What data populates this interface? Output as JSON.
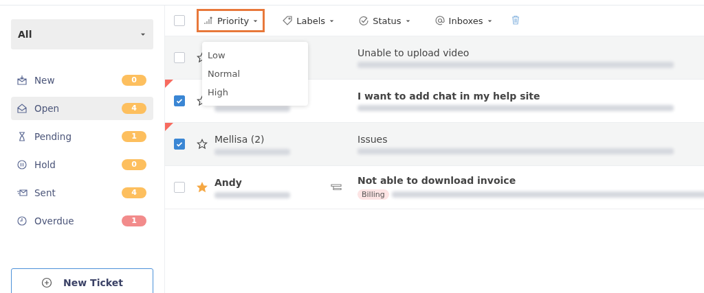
{
  "sidebar": {
    "filter": {
      "value": "All"
    },
    "items": [
      {
        "kind": "new",
        "label": "New",
        "count": "0",
        "color": "#fdbf5e",
        "selected": false
      },
      {
        "kind": "open",
        "label": "Open",
        "count": "4",
        "color": "#fdbf5e",
        "selected": true
      },
      {
        "kind": "pending",
        "label": "Pending",
        "count": "1",
        "color": "#fdbf5e",
        "selected": false
      },
      {
        "kind": "hold",
        "label": "Hold",
        "count": "0",
        "color": "#fdbf5e",
        "selected": false
      },
      {
        "kind": "sent",
        "label": "Sent",
        "count": "4",
        "color": "#fdbf5e",
        "selected": false
      },
      {
        "kind": "overdue",
        "label": "Overdue",
        "count": "1",
        "color": "#f28b8b",
        "selected": false
      }
    ],
    "new_ticket_button": "New Ticket"
  },
  "toolbar": {
    "select_all_checked": false,
    "buttons": [
      {
        "kind": "priority",
        "label": "Priority",
        "highlighted": true
      },
      {
        "kind": "labels",
        "label": "Labels",
        "highlighted": false
      },
      {
        "kind": "status",
        "label": "Status",
        "highlighted": false
      },
      {
        "kind": "inboxes",
        "label": "Inboxes",
        "highlighted": false
      }
    ]
  },
  "priority_menu": [
    "Low",
    "Normal",
    "High"
  ],
  "tickets": [
    {
      "checked": false,
      "starred": false,
      "flagged": false,
      "read": true,
      "has_note": false,
      "subject": "Unable to upload video"
    },
    {
      "checked": true,
      "starred": false,
      "flagged": true,
      "read": false,
      "has_note": false,
      "subject": "I want to add chat in my help site"
    },
    {
      "checked": true,
      "starred": false,
      "flagged": true,
      "read": true,
      "has_note": false,
      "name": "Mellisa (2)",
      "subject": "Issues"
    },
    {
      "checked": false,
      "starred": true,
      "flagged": false,
      "read": false,
      "name": "Andy",
      "has_note": true,
      "subject": "Not able to download invoice",
      "tag": "Billing"
    }
  ]
}
